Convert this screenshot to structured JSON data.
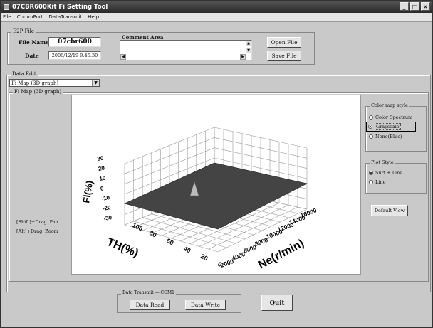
{
  "window": {
    "title": "07CBR600Kit Fi Setting Tool"
  },
  "menu": [
    "File",
    "CommPort",
    "DataTransmit",
    "Help"
  ],
  "e2p": {
    "group_label": "E2P File",
    "file_name_label": "File Name",
    "file_name_value": "07cbr600",
    "date_label": "Date",
    "date_value": "2006/12/19 9:45:30",
    "comment_label": "Comment Area",
    "comment_value": "",
    "open_label": "Open File",
    "save_label": "Save File"
  },
  "data_edit": {
    "group_label": "Data Edit",
    "selected_map": "Fi Map (3D graph)"
  },
  "fimap": {
    "group_label": "Fi Map (3D graph)",
    "hint_shift_key": "[Shift]+Drag",
    "hint_shift_action": "Pan",
    "hint_alt_key": "[Alt]+Drag",
    "hint_alt_action": "Zoom"
  },
  "graph": {
    "z_label": "Fi(%)",
    "x_label": "TH(%)",
    "y_label": "Ne(r/min)",
    "z_ticks": [
      "30",
      "20",
      "10",
      "0",
      "-10",
      "-20",
      "-30"
    ],
    "x_ticks": [
      "100",
      "80",
      "60",
      "40",
      "20",
      "0"
    ],
    "y_ticks": [
      "2000",
      "4000",
      "6000",
      "8000",
      "10000",
      "12000",
      "14000",
      "16000"
    ]
  },
  "color_style": {
    "group_label": "Color map style",
    "options": [
      "Color Spectrum",
      "Grayscale",
      "None(Blue)"
    ],
    "selected": "Grayscale"
  },
  "plot_style": {
    "group_label": "Plot Style",
    "options": [
      "Surf + Line",
      "Line"
    ],
    "selected": "Surf + Line"
  },
  "default_view_label": "Default View",
  "transmit": {
    "group_label": "Data Transmit",
    "port_label": "COM1",
    "read_label": "Data Read",
    "write_label": "Data Write"
  },
  "quit_label": "Quit"
}
